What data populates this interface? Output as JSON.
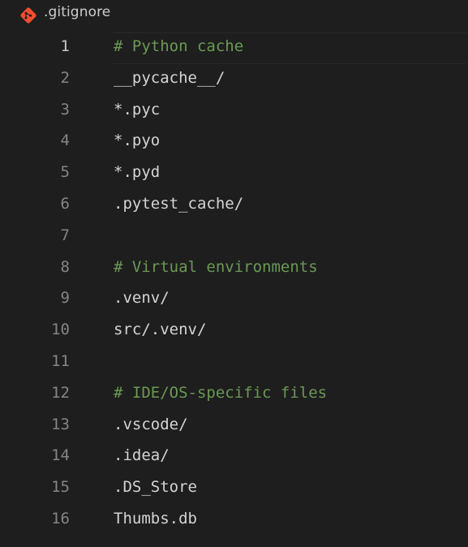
{
  "tab": {
    "filename": ".gitignore",
    "icon": "git-icon",
    "icon_color": "#f14e32"
  },
  "colors": {
    "background": "#1e1e1e",
    "comment": "#6a9955",
    "text": "#d4d4d4",
    "line_number": "#858585",
    "current_line_number": "#c6c6c6"
  },
  "editor": {
    "current_line": 1,
    "lines": [
      {
        "number": "1",
        "text": "# Python cache",
        "kind": "comment"
      },
      {
        "number": "2",
        "text": "__pycache__/",
        "kind": "text"
      },
      {
        "number": "3",
        "text": "*.pyc",
        "kind": "text"
      },
      {
        "number": "4",
        "text": "*.pyo",
        "kind": "text"
      },
      {
        "number": "5",
        "text": "*.pyd",
        "kind": "text"
      },
      {
        "number": "6",
        "text": ".pytest_cache/",
        "kind": "text"
      },
      {
        "number": "7",
        "text": "",
        "kind": "text"
      },
      {
        "number": "8",
        "text": "# Virtual environments",
        "kind": "comment"
      },
      {
        "number": "9",
        "text": ".venv/",
        "kind": "text"
      },
      {
        "number": "10",
        "text": "src/.venv/",
        "kind": "text"
      },
      {
        "number": "11",
        "text": "",
        "kind": "text"
      },
      {
        "number": "12",
        "text": "# IDE/OS-specific files",
        "kind": "comment"
      },
      {
        "number": "13",
        "text": ".vscode/",
        "kind": "text"
      },
      {
        "number": "14",
        "text": ".idea/",
        "kind": "text"
      },
      {
        "number": "15",
        "text": ".DS_Store",
        "kind": "text"
      },
      {
        "number": "16",
        "text": "Thumbs.db",
        "kind": "text"
      }
    ]
  }
}
